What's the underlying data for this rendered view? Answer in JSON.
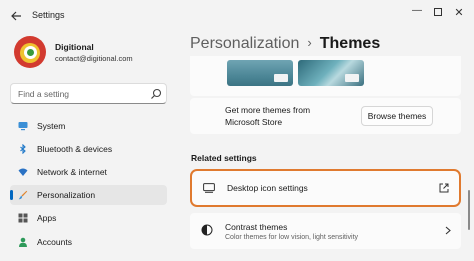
{
  "window": {
    "title": "Settings",
    "back_icon": "back-arrow-icon",
    "minimize_glyph": "—",
    "close_glyph": "✕"
  },
  "user": {
    "name": "Digitional",
    "email": "contact@digitional.com"
  },
  "search": {
    "placeholder": "Find a setting"
  },
  "sidebar": {
    "items": [
      {
        "label": "System",
        "icon": "monitor-icon",
        "active": false
      },
      {
        "label": "Bluetooth & devices",
        "icon": "bluetooth-icon",
        "active": false
      },
      {
        "label": "Network & internet",
        "icon": "wifi-icon",
        "active": false
      },
      {
        "label": "Personalization",
        "icon": "paintbrush-icon",
        "active": true
      },
      {
        "label": "Apps",
        "icon": "apps-icon",
        "active": false
      },
      {
        "label": "Accounts",
        "icon": "person-icon",
        "active": false
      }
    ]
  },
  "header": {
    "parent": "Personalization",
    "separator": "›",
    "current": "Themes"
  },
  "store": {
    "line1": "Get more themes from",
    "line2": "Microsoft Store",
    "button": "Browse themes"
  },
  "related": {
    "title": "Related settings",
    "desktop_icons": {
      "label": "Desktop icon settings",
      "icon": "desktop-icon",
      "trail_icon": "open-external-icon"
    },
    "contrast": {
      "label": "Contrast themes",
      "description": "Color themes for low vision, light sensitivity",
      "icon": "contrast-icon",
      "trail_icon": "chevron-right-icon"
    }
  },
  "colors": {
    "accent": "#0067c0",
    "highlight": "#e07a2f"
  }
}
